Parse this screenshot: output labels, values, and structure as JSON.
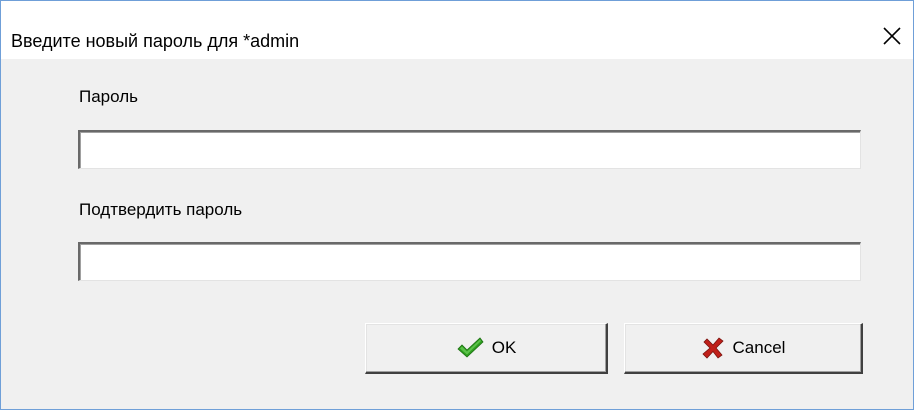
{
  "window": {
    "title": "Введите новый пароль для *admin"
  },
  "form": {
    "password_label": "Пароль",
    "password_value": "",
    "confirm_label": "Подтвердить пароль",
    "confirm_value": ""
  },
  "buttons": {
    "ok_label": "OK",
    "ok_icon": "checkmark-icon",
    "cancel_label": "Cancel",
    "cancel_icon": "red-x-icon"
  },
  "colors": {
    "ok_icon": "#2e9e1f",
    "cancel_icon": "#c0201a",
    "window_border": "#6f9fd8"
  }
}
